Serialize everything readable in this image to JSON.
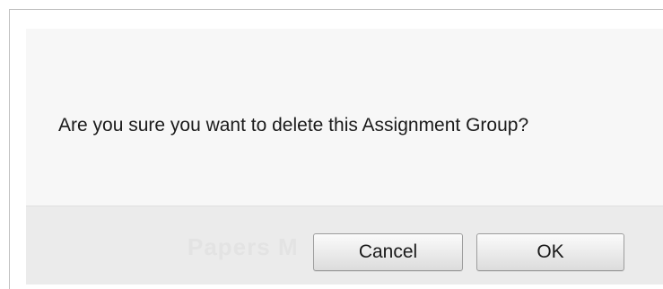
{
  "dialog": {
    "message": "Are you sure you want to delete this Assignment Group?",
    "background_text": "Papers M",
    "cancel_label": "Cancel",
    "ok_label": "OK"
  },
  "colors": {
    "body_background": "#f7f7f7",
    "footer_background": "#ebebeb",
    "button_border": "#9d9d9d",
    "text": "#1b1b1b"
  }
}
